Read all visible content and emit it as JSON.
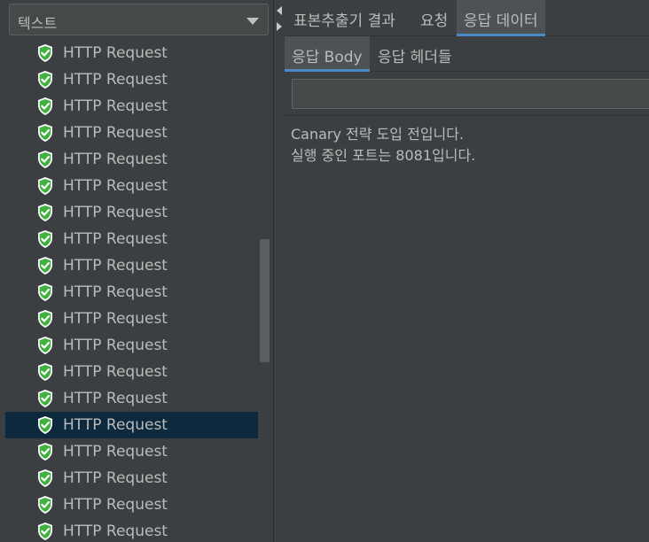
{
  "filter": {
    "selected": "텍스트"
  },
  "tree": {
    "item_label": "HTTP Request",
    "items": [
      {
        "label": "HTTP Request",
        "selected": false
      },
      {
        "label": "HTTP Request",
        "selected": false
      },
      {
        "label": "HTTP Request",
        "selected": false
      },
      {
        "label": "HTTP Request",
        "selected": false
      },
      {
        "label": "HTTP Request",
        "selected": false
      },
      {
        "label": "HTTP Request",
        "selected": false
      },
      {
        "label": "HTTP Request",
        "selected": false
      },
      {
        "label": "HTTP Request",
        "selected": false
      },
      {
        "label": "HTTP Request",
        "selected": false
      },
      {
        "label": "HTTP Request",
        "selected": false
      },
      {
        "label": "HTTP Request",
        "selected": false
      },
      {
        "label": "HTTP Request",
        "selected": false
      },
      {
        "label": "HTTP Request",
        "selected": false
      },
      {
        "label": "HTTP Request",
        "selected": false
      },
      {
        "label": "HTTP Request",
        "selected": true
      },
      {
        "label": "HTTP Request",
        "selected": false
      },
      {
        "label": "HTTP Request",
        "selected": false
      },
      {
        "label": "HTTP Request",
        "selected": false
      },
      {
        "label": "HTTP Request",
        "selected": false
      }
    ],
    "status_icon": "green-shield-check-icon"
  },
  "tabs": {
    "main": [
      {
        "label": "표본추출기 결과",
        "active": false
      },
      {
        "label": "요청",
        "active": false
      },
      {
        "label": "응답 데이터",
        "active": true
      }
    ],
    "sub": [
      {
        "label": "응답 Body",
        "active": true
      },
      {
        "label": "응답 헤더들",
        "active": false
      }
    ]
  },
  "search": {
    "value": "",
    "placeholder": ""
  },
  "response_body": {
    "lines": [
      "Canary 전략 도입 전입니다.",
      "실행 중인 포트는 8081입니다."
    ]
  },
  "colors": {
    "background": "#3c3f41",
    "selection": "#0d293e",
    "tab_accent": "#4a88c7",
    "success_green": "#3fb13f"
  }
}
